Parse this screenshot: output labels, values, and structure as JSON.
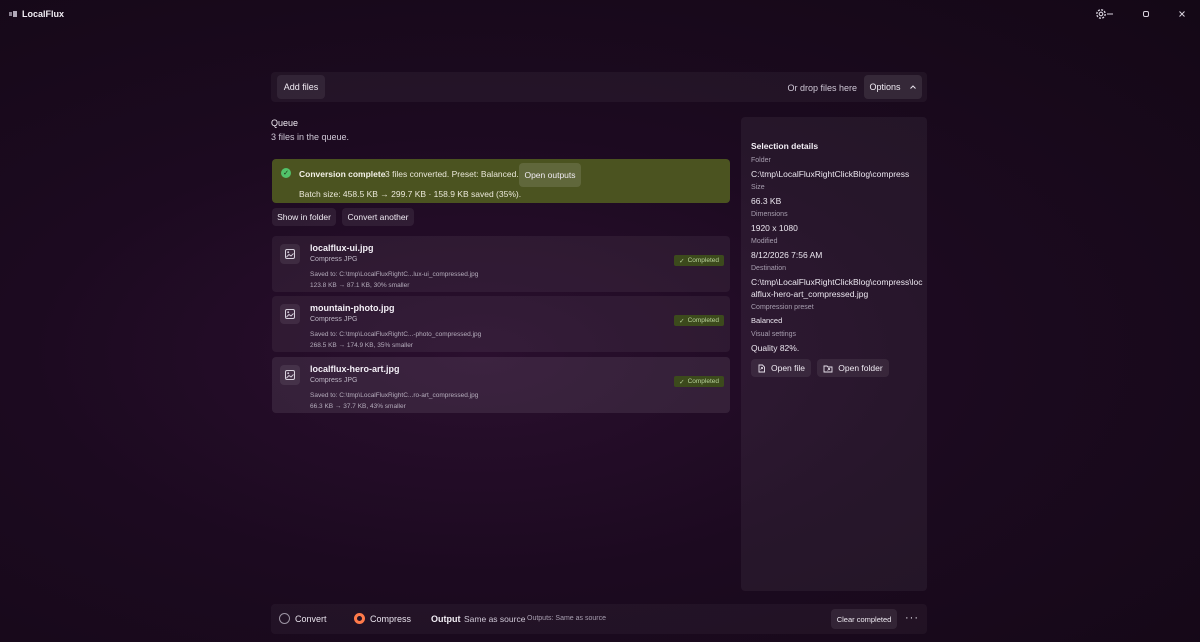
{
  "app": {
    "title": "LocalFlux"
  },
  "toolbar": {
    "add_files": "Add files",
    "drop_hint": "Or drop files here",
    "options": "Options"
  },
  "queue": {
    "title": "Queue",
    "subtitle": "3 files in the queue."
  },
  "banner": {
    "title": "Conversion complete",
    "message": "3 files converted. Preset: Balanced.",
    "detail": "Batch size: 458.5 KB → 299.7 KB · 158.9 KB saved (35%).",
    "open_outputs": "Open outputs"
  },
  "actions": {
    "show_in_folder": "Show in folder",
    "convert_another": "Convert another"
  },
  "files": [
    {
      "name": "localflux-ui.jpg",
      "operation": "Compress JPG",
      "saved_to": "Saved to: C:\\tmp\\LocalFluxRightC...lux-ui_compressed.jpg",
      "size": "123.8 KB → 87.1 KB, 30% smaller",
      "status": "Completed"
    },
    {
      "name": "mountain-photo.jpg",
      "operation": "Compress JPG",
      "saved_to": "Saved to: C:\\tmp\\LocalFluxRightC...-photo_compressed.jpg",
      "size": "268.5 KB → 174.9 KB, 35% smaller",
      "status": "Completed"
    },
    {
      "name": "localflux-hero-art.jpg",
      "operation": "Compress JPG",
      "saved_to": "Saved to: C:\\tmp\\LocalFluxRightC...ro-art_compressed.jpg",
      "size": "66.3 KB → 37.7 KB, 43% smaller",
      "status": "Completed"
    }
  ],
  "details": {
    "title": "Selection details",
    "folder_label": "Folder",
    "folder": "C:\\tmp\\LocalFluxRightClickBlog\\compress",
    "size_label": "Size",
    "size": "66.3 KB",
    "dimensions_label": "Dimensions",
    "dimensions": "1920 x 1080",
    "modified_label": "Modified",
    "modified": "8/12/2026 7:56 AM",
    "destination_label": "Destination",
    "destination": "C:\\tmp\\LocalFluxRightClickBlog\\compress\\localflux-hero-art_compressed.jpg",
    "preset_label": "Compression preset",
    "preset": "Balanced",
    "visual_label": "Visual settings",
    "visual": "Quality 82%.",
    "open_file": "Open file",
    "open_folder": "Open folder"
  },
  "bottom": {
    "convert": "Convert",
    "compress": "Compress",
    "output_label": "Output",
    "output_value": "Same as source",
    "outputs_text": "Outputs: Same as source",
    "clear_completed": "Clear completed",
    "more": "···"
  },
  "colors": {
    "banner": "#4b5320",
    "badge": "#3c4a1c",
    "accent": "#ff7a4a",
    "success": "#52c26a"
  }
}
